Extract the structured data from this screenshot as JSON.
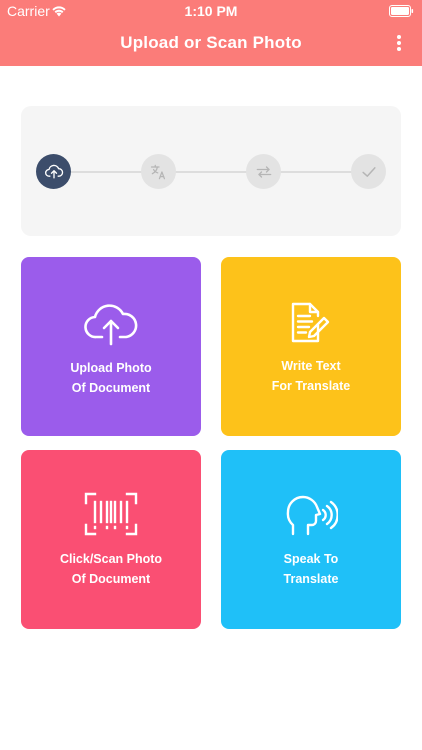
{
  "status_bar": {
    "carrier": "Carrier",
    "time": "1:10 PM"
  },
  "header": {
    "title": "Upload or Scan Photo",
    "menu_icon": "more-vertical-icon",
    "background_color": "#fb7c79"
  },
  "stepper": {
    "steps": [
      {
        "icon": "cloud-upload-icon",
        "active": true
      },
      {
        "icon": "translate-icon",
        "active": false
      },
      {
        "icon": "swap-icon",
        "active": false
      },
      {
        "icon": "check-icon",
        "active": false
      }
    ],
    "active_color": "#3c4d6b"
  },
  "tiles": [
    {
      "id": "upload",
      "icon": "cloud-upload-icon",
      "line1": "Upload Photo",
      "line2": "Of Document",
      "color": "#9b5ceb"
    },
    {
      "id": "write",
      "icon": "document-edit-icon",
      "line1": "Write Text",
      "line2": "For Translate",
      "color": "#fdc21a"
    },
    {
      "id": "scan",
      "icon": "barcode-scan-icon",
      "line1": "Click/Scan Photo",
      "line2": "Of Document",
      "color": "#fa4f73"
    },
    {
      "id": "speak",
      "icon": "speaking-head-icon",
      "line1": "Speak To",
      "line2": "Translate",
      "color": "#1fc0f8"
    }
  ]
}
